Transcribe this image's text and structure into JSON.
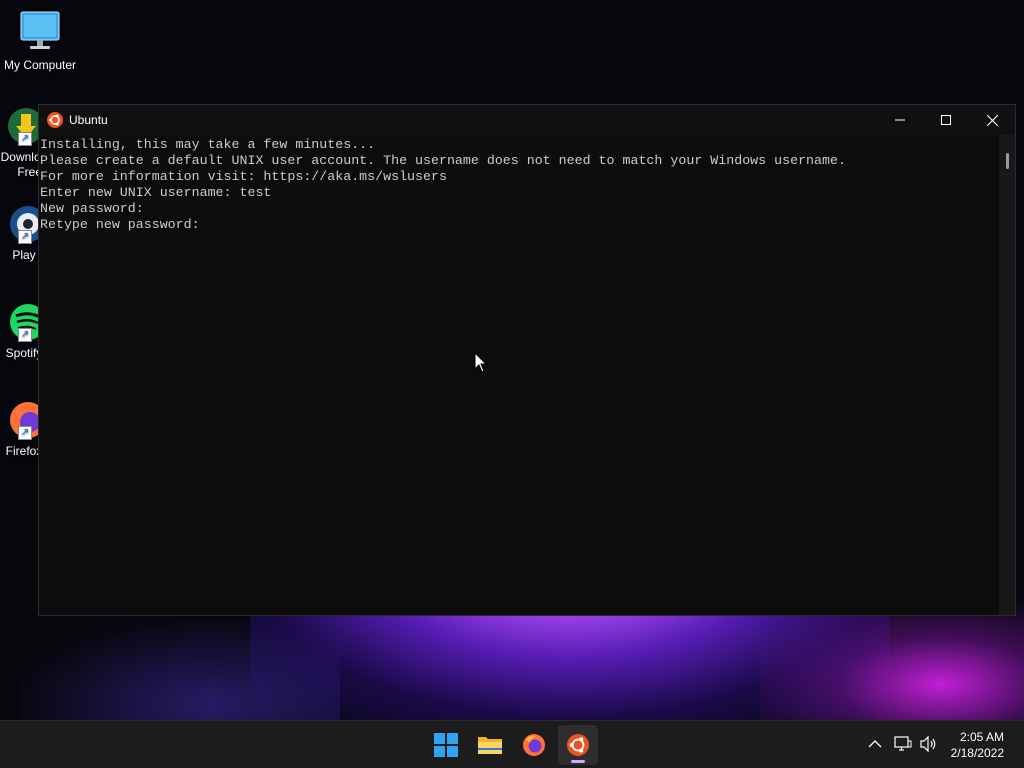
{
  "desktop": {
    "icons": [
      {
        "label": "My Computer"
      },
      {
        "label": "Download Free C"
      },
      {
        "label": "Play"
      },
      {
        "label": "Spotify"
      },
      {
        "label": "Firefox"
      }
    ]
  },
  "window": {
    "title": "Ubuntu",
    "lines": [
      "Installing, this may take a few minutes...",
      "Please create a default UNIX user account. The username does not need to match your Windows username.",
      "For more information visit: https://aka.ms/wslusers",
      "Enter new UNIX username: test",
      "New password:",
      "Retype new password:"
    ]
  },
  "taskbar": {
    "clock_time": "2:05 AM",
    "clock_date": "2/18/2022"
  },
  "colors": {
    "ubuntu_orange": "#e95420",
    "windows_blue": "#2ea3f2",
    "accent_indicator": "#d3a9ff"
  }
}
